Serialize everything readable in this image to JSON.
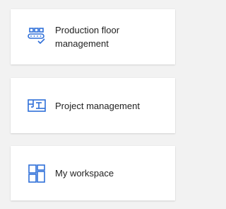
{
  "cards": [
    {
      "label": "Production floor management",
      "icon": "conveyor-checklist-icon"
    },
    {
      "label": "Project management",
      "icon": "blueprint-icon"
    },
    {
      "label": "My workspace",
      "icon": "workspace-layout-icon"
    }
  ],
  "colors": {
    "background": "#f2f2f2",
    "card": "#ffffff",
    "accent": "#2f6fd8",
    "text": "#1f1f1f"
  }
}
